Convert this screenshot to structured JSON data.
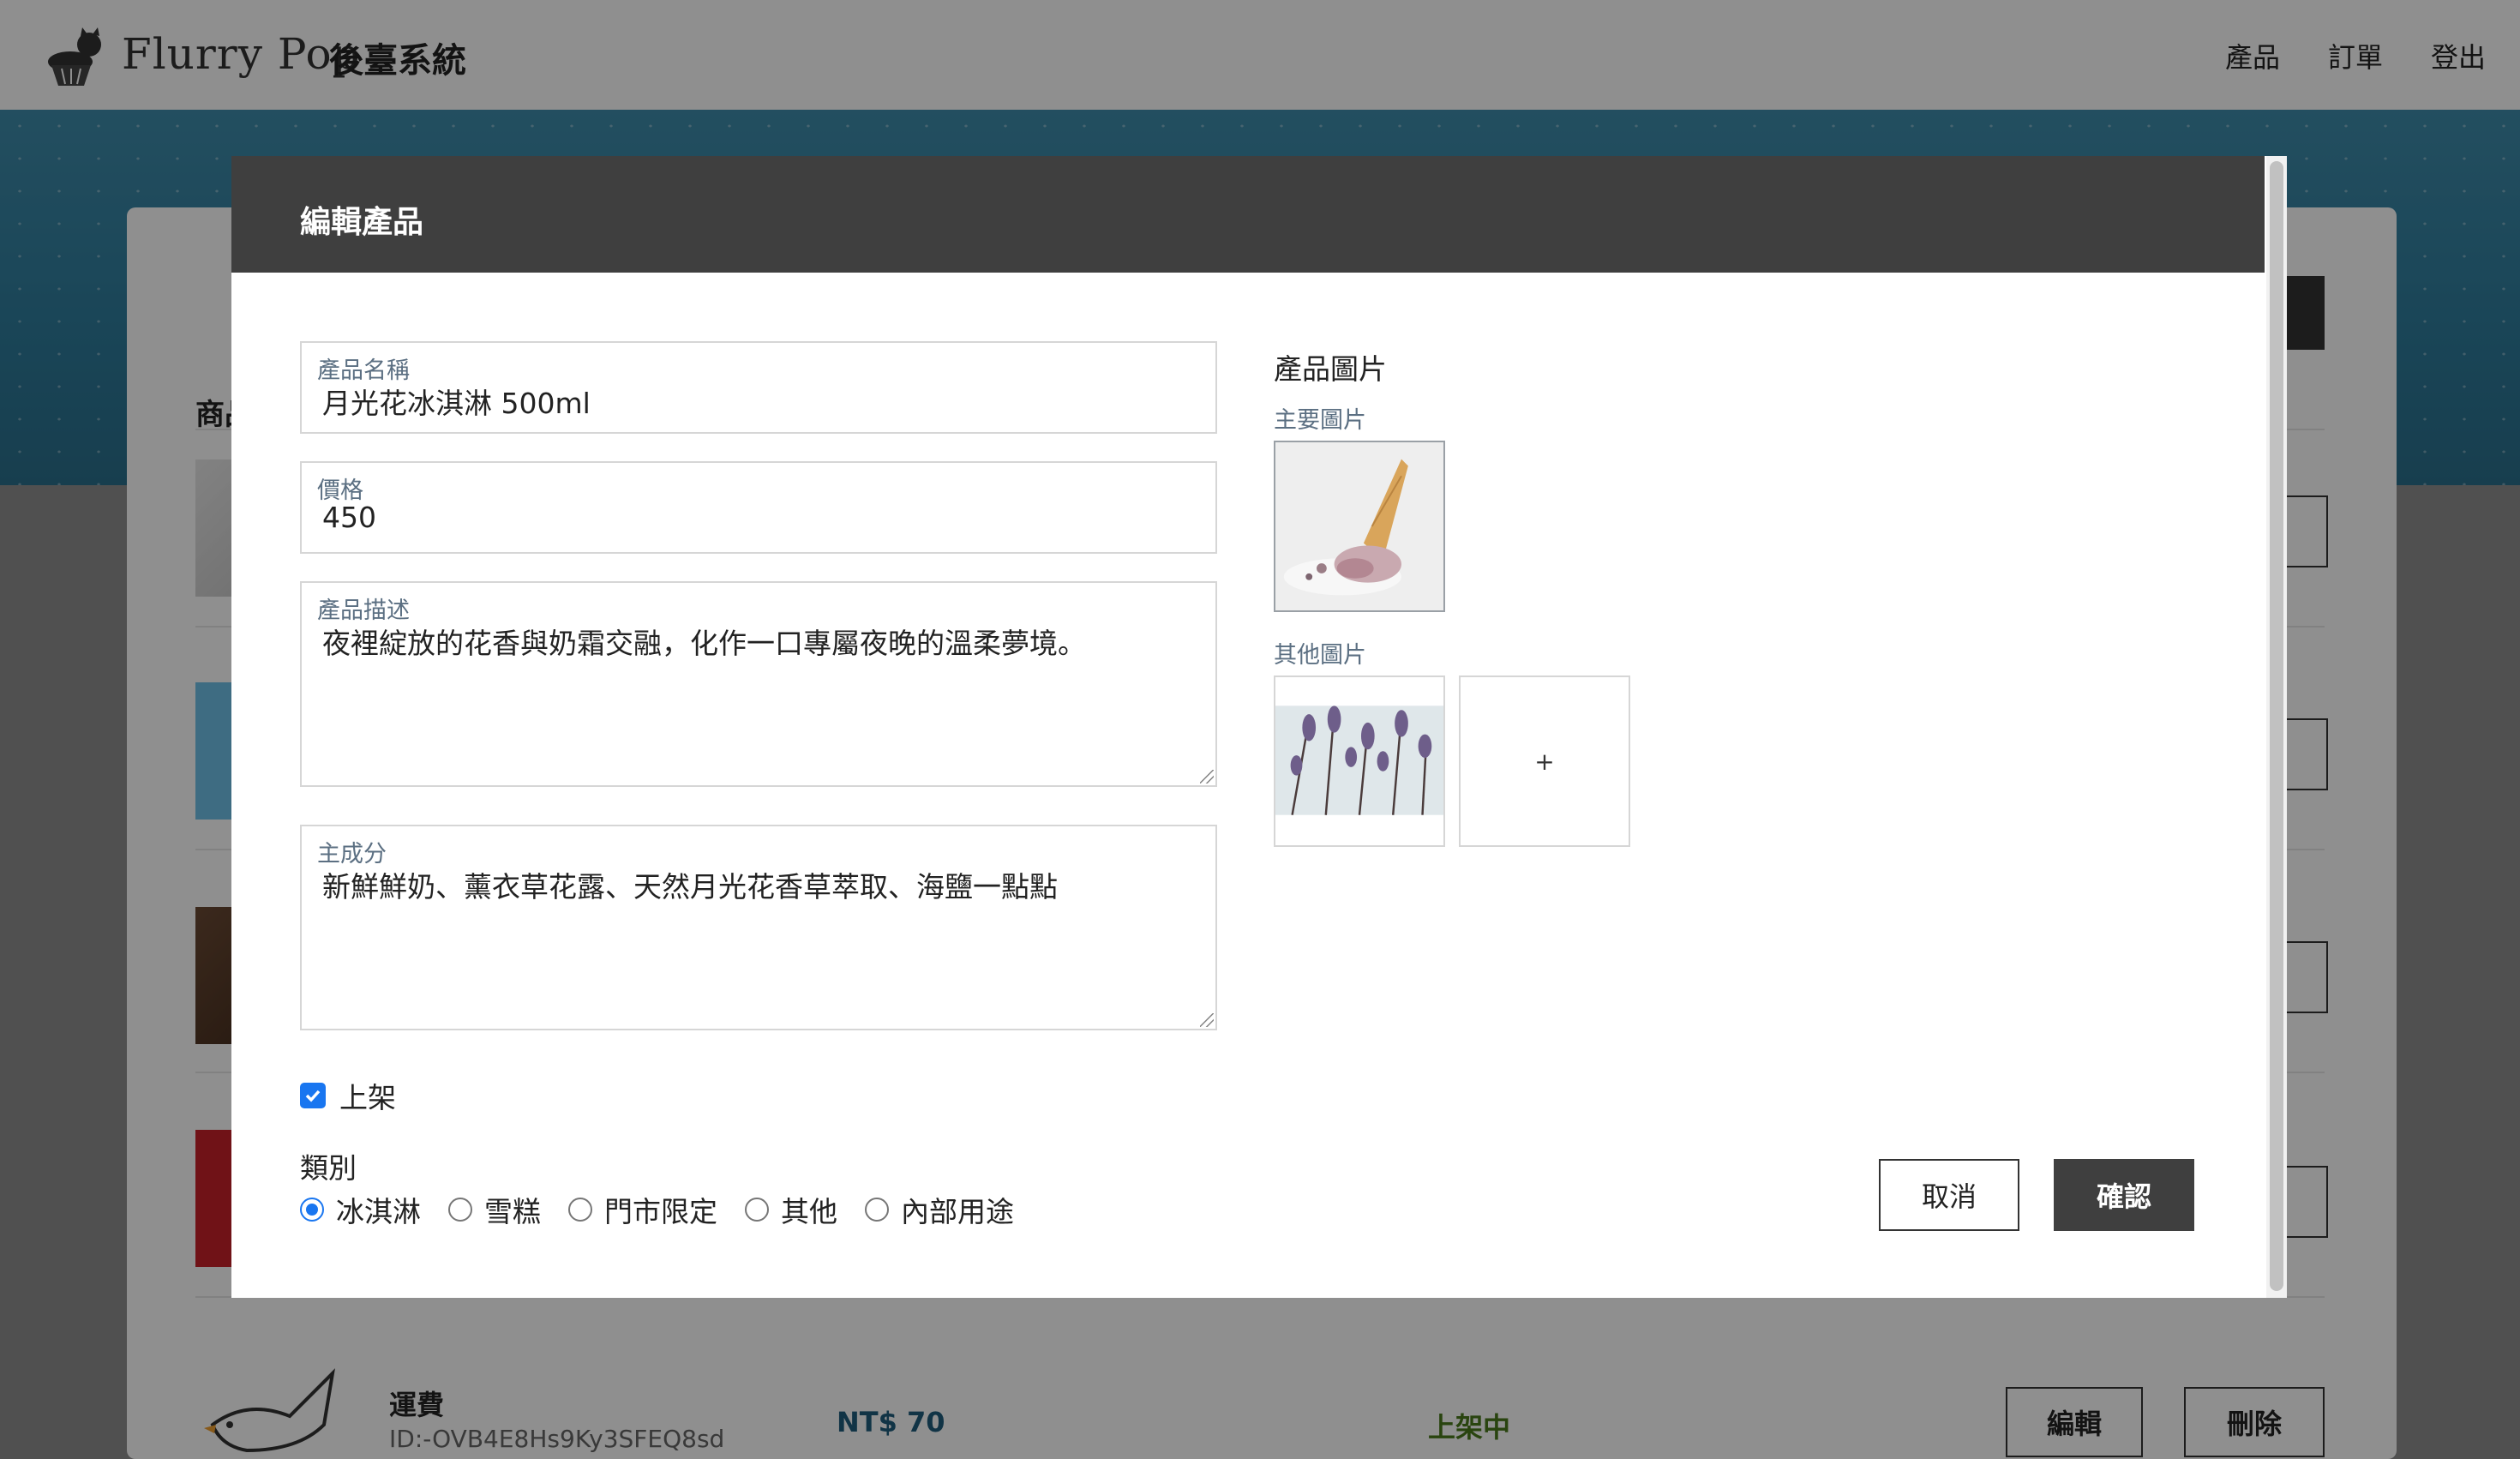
{
  "navbar": {
    "brand": "Flurry Pop",
    "system_title": "後臺系統",
    "links": [
      "產品",
      "訂單",
      "登出"
    ]
  },
  "background": {
    "list_heading": "商品",
    "shipping_row": {
      "name": "運費",
      "id": "ID:-OVB4E8Hs9Ky3SFEQ8sd",
      "price": "NT$ 70",
      "status": "上架中",
      "edit_label": "編輯",
      "delete_label": "刪除"
    }
  },
  "modal": {
    "title": "編輯產品",
    "fields": {
      "name": {
        "label": "產品名稱",
        "value": "月光花冰淇淋 500ml"
      },
      "price": {
        "label": "價格",
        "value": "450"
      },
      "description": {
        "label": "產品描述",
        "value": "夜裡綻放的花香與奶霜交融，化作一口專屬夜晚的溫柔夢境。"
      },
      "ingredients": {
        "label": "主成分",
        "value": "新鮮鮮奶、薰衣草花露、天然月光花香草萃取、海鹽一點點"
      }
    },
    "published": {
      "label": "上架",
      "checked": true
    },
    "category": {
      "label": "類別",
      "options": [
        "冰淇淋",
        "雪糕",
        "門市限定",
        "其他",
        "內部用途"
      ],
      "selected": "冰淇淋"
    },
    "images": {
      "section_title": "產品圖片",
      "main_label": "主要圖片",
      "other_label": "其他圖片",
      "add_symbol": "+"
    },
    "buttons": {
      "cancel": "取消",
      "confirm": "確認"
    }
  },
  "colors": {
    "header_dark": "#3f3f3f",
    "accent_blue": "#1976f0",
    "label_gray": "#5b6f82",
    "price_blue": "#1f5d7d",
    "status_green": "#4a7a1c"
  }
}
